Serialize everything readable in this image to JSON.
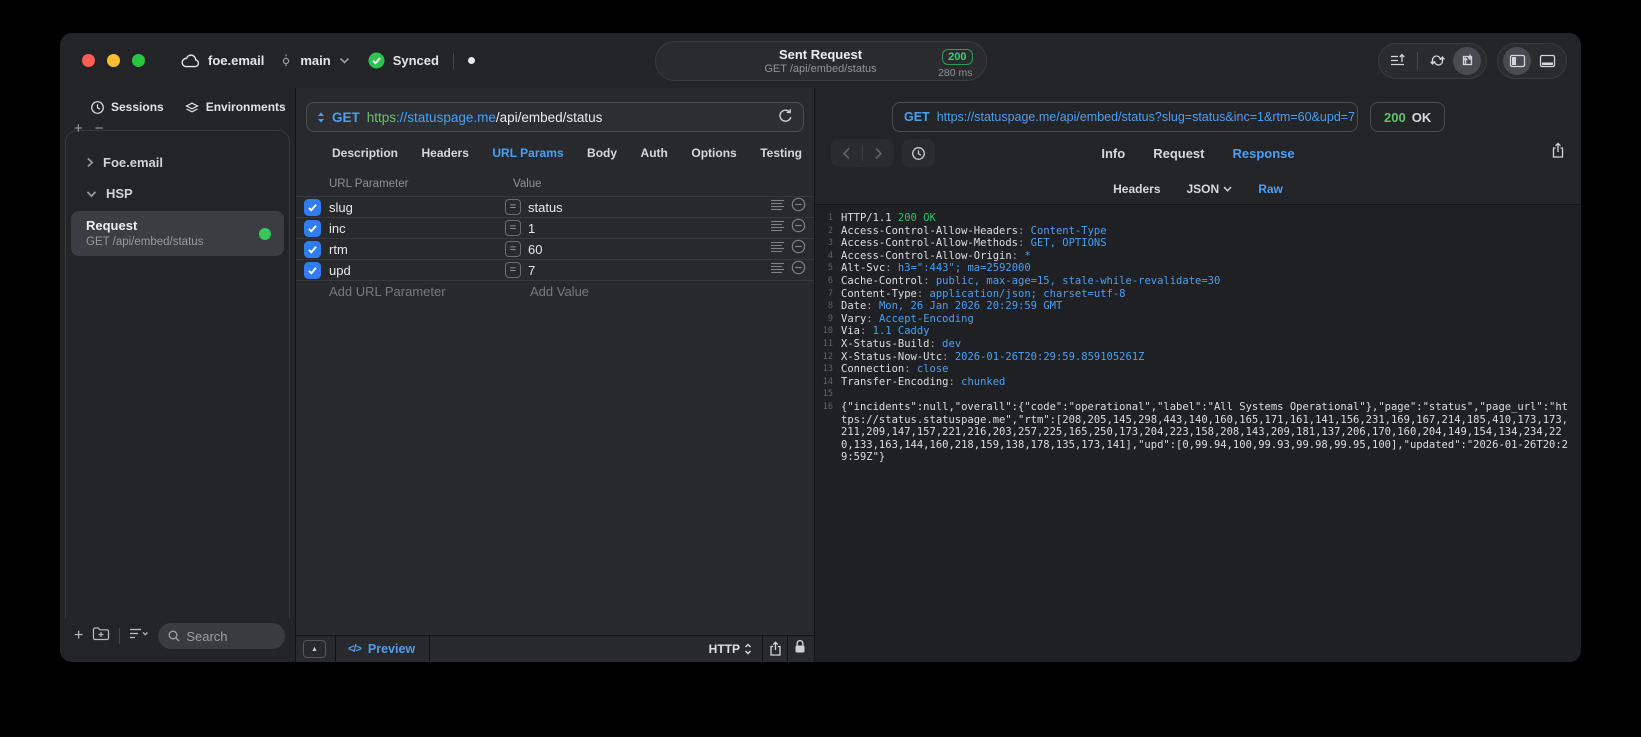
{
  "titlebar": {
    "project": "foe.email",
    "branch": "main",
    "sync": "Synced",
    "pill": {
      "title": "Sent Request",
      "subtitle": "GET /api/embed/status",
      "status": "200",
      "time": "280 ms"
    }
  },
  "sidebar": {
    "tabs": [
      "Sessions",
      "Environments"
    ],
    "tree": [
      {
        "label": "Foe.email"
      },
      {
        "label": "HSP"
      }
    ],
    "request": {
      "title": "Request",
      "subtitle": "GET /api/embed/status"
    },
    "search": "Search"
  },
  "editor": {
    "method": "GET",
    "scheme": "https",
    "host": "://statuspage.me",
    "path": "/api/embed/status",
    "tabs": [
      "Description",
      "Headers",
      "URL Params",
      "Body",
      "Auth",
      "Options",
      "Testing"
    ],
    "active_tab": "URL Params",
    "table": {
      "col1": "URL Parameter",
      "col2": "Value",
      "rows": [
        {
          "name": "slug",
          "value": "status",
          "enabled": true
        },
        {
          "name": "inc",
          "value": "1",
          "enabled": true
        },
        {
          "name": "rtm",
          "value": "60",
          "enabled": true
        },
        {
          "name": "upd",
          "value": "7",
          "enabled": true
        }
      ],
      "add_name": "Add URL Parameter",
      "add_value": "Add Value"
    },
    "footer": {
      "preview": "Preview",
      "protocol": "HTTP"
    }
  },
  "viewer": {
    "method": "GET",
    "url": "https://statuspage.me/api/embed/status?slug=status&inc=1&rtm=60&upd=7",
    "status": "200",
    "status_text": "OK",
    "tabs": [
      "Info",
      "Request",
      "Response"
    ],
    "active_tab": "Response",
    "subtabs": [
      "Headers",
      "JSON",
      "Raw"
    ],
    "active_subtab": "Raw",
    "code": [
      {
        "n": 1,
        "parts": [
          {
            "t": "HTTP/1.1 ",
            "c": "p"
          },
          {
            "t": "200 OK",
            "c": "g"
          }
        ]
      },
      {
        "n": 2,
        "parts": [
          {
            "t": "Access-Control-Allow-Headers",
            "c": "p"
          },
          {
            "t": ": ",
            "c": "d"
          },
          {
            "t": "Content-Type",
            "c": "b"
          }
        ]
      },
      {
        "n": 3,
        "parts": [
          {
            "t": "Access-Control-Allow-Methods",
            "c": "p"
          },
          {
            "t": ": ",
            "c": "d"
          },
          {
            "t": "GET, OPTIONS",
            "c": "b"
          }
        ]
      },
      {
        "n": 4,
        "parts": [
          {
            "t": "Access-Control-Allow-Origin",
            "c": "p"
          },
          {
            "t": ": ",
            "c": "d"
          },
          {
            "t": "*",
            "c": "b"
          }
        ]
      },
      {
        "n": 5,
        "parts": [
          {
            "t": "Alt-Svc",
            "c": "p"
          },
          {
            "t": ": ",
            "c": "d"
          },
          {
            "t": "h3=\":443\"; ma=2592000",
            "c": "b"
          }
        ]
      },
      {
        "n": 6,
        "parts": [
          {
            "t": "Cache-Control",
            "c": "p"
          },
          {
            "t": ": ",
            "c": "d"
          },
          {
            "t": "public, max-age=15, stale-while-revalidate=30",
            "c": "b"
          }
        ]
      },
      {
        "n": 7,
        "parts": [
          {
            "t": "Content-Type",
            "c": "p"
          },
          {
            "t": ": ",
            "c": "d"
          },
          {
            "t": "application/json; charset=utf-8",
            "c": "b"
          }
        ]
      },
      {
        "n": 8,
        "parts": [
          {
            "t": "Date",
            "c": "p"
          },
          {
            "t": ": ",
            "c": "d"
          },
          {
            "t": "Mon, 26 Jan 2026 20:29:59 GMT",
            "c": "b"
          }
        ]
      },
      {
        "n": 9,
        "parts": [
          {
            "t": "Vary",
            "c": "p"
          },
          {
            "t": ": ",
            "c": "d"
          },
          {
            "t": "Accept-Encoding",
            "c": "b"
          }
        ]
      },
      {
        "n": 10,
        "parts": [
          {
            "t": "Via",
            "c": "p"
          },
          {
            "t": ": ",
            "c": "d"
          },
          {
            "t": "1.1 Caddy",
            "c": "b"
          }
        ]
      },
      {
        "n": 11,
        "parts": [
          {
            "t": "X-Status-Build",
            "c": "p"
          },
          {
            "t": ": ",
            "c": "d"
          },
          {
            "t": "dev",
            "c": "b"
          }
        ]
      },
      {
        "n": 12,
        "parts": [
          {
            "t": "X-Status-Now-Utc",
            "c": "p"
          },
          {
            "t": ": ",
            "c": "d"
          },
          {
            "t": "2026-01-26T20:29:59.859105261Z",
            "c": "b"
          }
        ]
      },
      {
        "n": 13,
        "parts": [
          {
            "t": "Connection",
            "c": "p"
          },
          {
            "t": ": ",
            "c": "d"
          },
          {
            "t": "close",
            "c": "b"
          }
        ]
      },
      {
        "n": 14,
        "parts": [
          {
            "t": "Transfer-Encoding",
            "c": "p"
          },
          {
            "t": ": ",
            "c": "d"
          },
          {
            "t": "chunked",
            "c": "b"
          }
        ]
      },
      {
        "n": 15,
        "parts": []
      },
      {
        "n": 16,
        "parts": [
          {
            "t": "{\"incidents\":null,\"overall\":{\"code\":\"operational\",\"label\":\"All Systems Operational\"},\"page\":\"status\",\"page_url\":\"https://status.statuspage.me\",\"rtm\":[208,205,145,298,443,140,160,165,171,161,141,156,231,169,167,214,185,410,173,173,211,209,147,157,221,216,203,257,225,165,250,173,204,223,158,208,143,209,181,137,206,170,160,204,149,154,134,234,220,133,163,144,160,218,159,138,178,135,173,141],\"upd\":[0,99.94,100,99.93,99.98,99.95,100],\"updated\":\"2026-01-26T20:29:59Z\"}",
            "c": "p"
          }
        ]
      }
    ]
  },
  "icons": {
    "plus": "+",
    "minus": "−",
    "collapse": "▲",
    "code": "</>",
    "eq": "="
  },
  "colors": {
    "accent": "#4b9ff2",
    "green": "#35c05f",
    "checkbox": "#2f7df0",
    "status_dot": "#37c75a"
  }
}
